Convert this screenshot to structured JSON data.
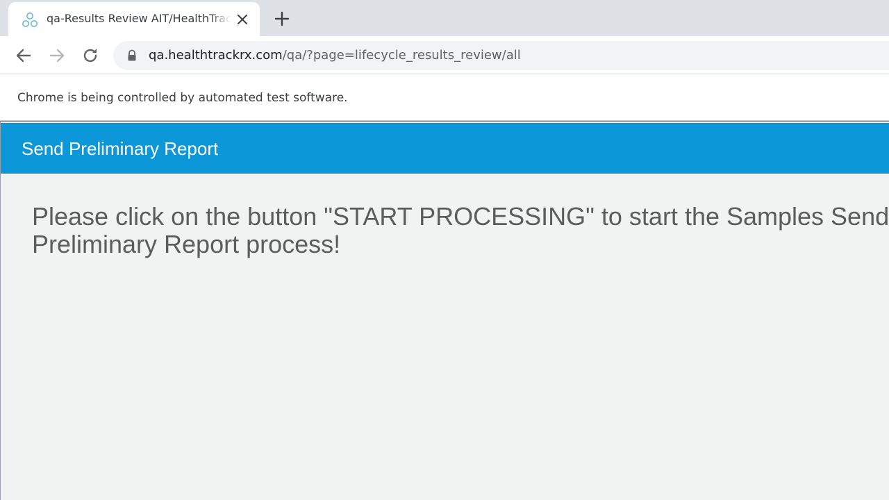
{
  "browser": {
    "tab": {
      "title": "qa-Results Review AIT/HealthTrackRx",
      "favicon": "healthtrackrx-molecule-icon"
    },
    "new_tab_icon": "plus-icon",
    "nav": {
      "back_icon": "arrow-left-icon",
      "forward_icon": "arrow-right-icon",
      "reload_icon": "reload-icon"
    },
    "address_bar": {
      "lock_icon": "lock-icon",
      "host": "qa.healthtrackrx.com",
      "path": "/qa/?page=lifecycle_results_review/all"
    },
    "infobar_text": "Chrome is being controlled by automated test software."
  },
  "page": {
    "title": "Send Preliminary Report",
    "message": "Please click on the button \"START PROCESSING\" to start the Samples Send Preliminary Report process!"
  },
  "colors": {
    "header_blue": "#0c98d8",
    "page_background": "#f0f3f2",
    "message_text": "#5c5c5c",
    "tabstrip": "#dee1e6"
  }
}
